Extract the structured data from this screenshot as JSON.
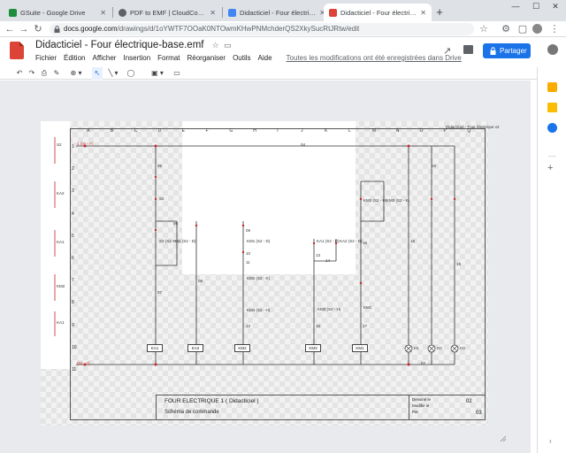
{
  "browser": {
    "tabs": [
      {
        "label": "GSuite - Google Drive",
        "color": "#1e8e3e"
      },
      {
        "label": "PDF to EMF | CloudConvert",
        "color": "#5f6368"
      },
      {
        "label": "Didacticiel - Four électrique-bas",
        "color": "#4285f4"
      },
      {
        "label": "Didacticiel - Four électrique-bas",
        "color": "#db4437"
      }
    ],
    "new_tab": "+",
    "url_host": "docs.google.com",
    "url_path": "/drawings/d/1oYWTF7OOaK0NTOwmKHwPNMchderQS2XkySucRtJRtw/edit"
  },
  "app": {
    "title": "Didacticiel - Four électrique-base.emf",
    "menu": [
      "Fichier",
      "Édition",
      "Afficher",
      "Insertion",
      "Format",
      "Réorganiser",
      "Outils",
      "Aide"
    ],
    "save_status": "Toutes les modifications ont été enregistrées dans Drive",
    "share_label": "Partager",
    "brand_color": "#1a73e8"
  },
  "toolbar": {
    "undo": "↶",
    "redo": "↷",
    "print": "⎙",
    "paint": "✎",
    "zoom": "⊕ ▾",
    "select": "↖",
    "line": "╲ ▾",
    "shape": "◯",
    "image": "▣ ▾",
    "comment": "▭"
  },
  "drawing": {
    "columns": [
      "A",
      "B",
      "C",
      "D",
      "E",
      "F",
      "G",
      "H",
      "I",
      "J",
      "K",
      "L",
      "M",
      "N",
      "O",
      "P",
      "Q"
    ],
    "rows": [
      "1",
      "2",
      "3",
      "4",
      "5",
      "6",
      "7",
      "8",
      "9",
      "10",
      "11"
    ],
    "left_labels": [
      "S2",
      "KA2",
      "KA1",
      "KM2",
      "KA1"
    ],
    "line_labels": {
      "l1": "1 (01 - F)",
      "l2": "(01 - 2)",
      "n04": "04",
      "n04b": "04",
      "n02": "02"
    },
    "relays": [
      "KA1",
      "KA2",
      "KM2",
      "KM3",
      "KM1"
    ],
    "lamps": [
      "H1",
      "H2",
      "H3"
    ],
    "contacts": [
      "S2",
      "S3 (S2 - D)",
      "KA1 (S2 - D)",
      "KM3 (S2 - H)",
      "KM2 (S2 - K)",
      "KA1 (S2 - D)",
      "KA2 (S2 - D)",
      "KM1 (S2 - D)",
      "KM3 (S2 - H)",
      "KM2 (S2 - H)",
      "KM3 (S2 - K)",
      "KM1"
    ],
    "wire_numbers": [
      "05",
      "06",
      "07",
      "08",
      "09",
      "10",
      "11",
      "12",
      "13",
      "14",
      "15",
      "16",
      "17",
      "18",
      "19"
    ],
    "corner_note": "Didacticiel - Four électrique v2",
    "title_block": {
      "title": "FOUR ELECTRIQUE 1 ( Didacticiel )",
      "subtitle": "Schéma de commande",
      "created": "Dessiné le",
      "modified": "Modifié le",
      "by": "Par",
      "sheet": "02",
      "total": "03"
    }
  }
}
